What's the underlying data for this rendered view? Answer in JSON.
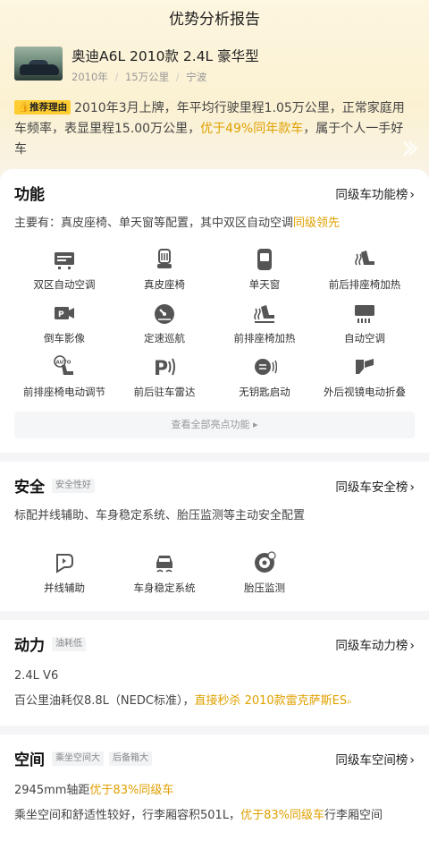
{
  "nav": {
    "title": "优势分析报告"
  },
  "car": {
    "name": "奥迪A6L 2010款 2.4L 豪华型",
    "year": "2010年",
    "mileage": "15万公里",
    "city": "宁波",
    "sep": "/"
  },
  "reason": {
    "badge": "推荐理由",
    "text_a": "2010年3月上牌，年平均行驶里程1.05万公里，正常家庭用车频率，表显里程15.00万公里，",
    "highlight": "优于49%同年款车",
    "text_b": "，属于个人一手好车"
  },
  "features": {
    "title": "功能",
    "rank_link": "同级车功能榜",
    "desc_a": "主要有：真皮座椅、单天窗等配置，其中双区自动空调",
    "desc_hl": "同级领先",
    "items": [
      {
        "label": "双区自动空调",
        "icon": "dual-zone-ac-icon"
      },
      {
        "label": "真皮座椅",
        "icon": "leather-seat-icon"
      },
      {
        "label": "单天窗",
        "icon": "sunroof-icon"
      },
      {
        "label": "前后排座椅加热",
        "icon": "seat-heating-icon"
      },
      {
        "label": "倒车影像",
        "icon": "reverse-camera-icon"
      },
      {
        "label": "定速巡航",
        "icon": "cruise-control-icon"
      },
      {
        "label": "前排座椅加热",
        "icon": "front-seat-heating-icon"
      },
      {
        "label": "自动空调",
        "icon": "auto-ac-icon"
      },
      {
        "label": "前排座椅电动调节",
        "icon": "power-seat-icon"
      },
      {
        "label": "前后驻车雷达",
        "icon": "parking-radar-icon"
      },
      {
        "label": "无钥匙启动",
        "icon": "keyless-start-icon"
      },
      {
        "label": "外后视镜电动折叠",
        "icon": "mirror-fold-icon"
      }
    ],
    "more": "查看全部亮点功能 ▸"
  },
  "safety": {
    "title": "安全",
    "tag": "安全性好",
    "rank_link": "同级车安全榜",
    "desc": "标配并线辅助、车身稳定系统、胎压监测等主动安全配置",
    "items": [
      {
        "label": "并线辅助",
        "icon": "lane-assist-icon"
      },
      {
        "label": "车身稳定系统",
        "icon": "stability-control-icon"
      },
      {
        "label": "胎压监测",
        "icon": "tire-pressure-icon"
      }
    ]
  },
  "power": {
    "title": "动力",
    "tag": "油耗低",
    "rank_link": "同级车动力榜",
    "engine": "2.4L V6",
    "fuel_a": "百公里油耗仅8.8L（NEDC标准），",
    "fuel_hl": "直接秒杀 2010款雷克萨斯ES"
  },
  "space": {
    "title": "空间",
    "tag1": "乘坐空间大",
    "tag2": "后备箱大",
    "rank_link": "同级车空间榜",
    "wheelbase_a": "2945mm轴距",
    "wheelbase_hl": "优于83%同级车",
    "desc_a": "乘坐空间和舒适性较好，行李厢容积501L，",
    "desc_hl": "优于83%同级车",
    "desc_b": "行李厢空间"
  },
  "colors": {
    "accent": "#e0a000",
    "badge": "#ffcd32"
  }
}
